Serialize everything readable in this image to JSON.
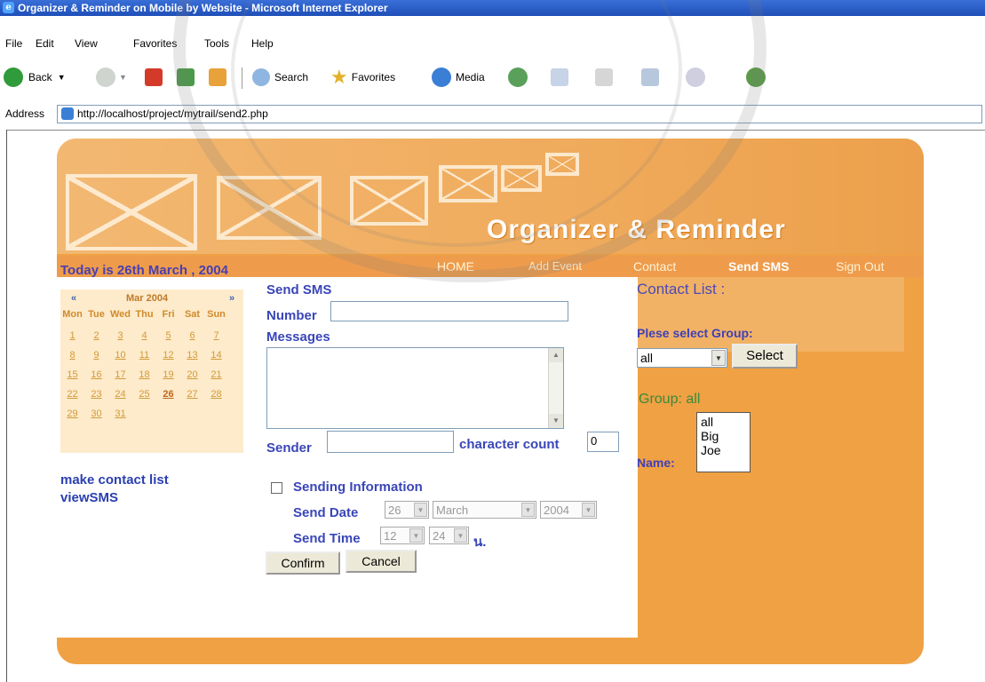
{
  "window": {
    "title": "Organizer & Reminder on Mobile by Website - Microsoft Internet Explorer"
  },
  "menu": [
    "File",
    "Edit",
    "View",
    "Favorites",
    "Tools",
    "Help"
  ],
  "toolbar": {
    "back": "Back",
    "search": "Search",
    "favorites": "Favorites",
    "media": "Media"
  },
  "address": {
    "label": "Address",
    "url": "http://localhost/project/mytrail/send2.php"
  },
  "site": {
    "title": "Organizer & Reminder",
    "today": "Today is 26th March , 2004",
    "nav": [
      "HOME",
      "Add Event",
      "Contact",
      "Send SMS",
      "Sign Out"
    ],
    "active_nav": "Send SMS"
  },
  "calendar": {
    "prev": "«",
    "next": "»",
    "month": "Mar 2004",
    "days": [
      "Mon",
      "Tue",
      "Wed",
      "Thu",
      "Fri",
      "Sat",
      "Sun"
    ],
    "weeks": [
      [
        "1",
        "2",
        "3",
        "4",
        "5",
        "6",
        "7"
      ],
      [
        "8",
        "9",
        "10",
        "11",
        "12",
        "13",
        "14"
      ],
      [
        "15",
        "16",
        "17",
        "18",
        "19",
        "20",
        "21"
      ],
      [
        "22",
        "23",
        "24",
        "25",
        "26",
        "27",
        "28"
      ],
      [
        "29",
        "30",
        "31",
        "",
        "",
        "",
        ""
      ]
    ],
    "today": "26"
  },
  "sidebar": {
    "links": [
      "make contact list",
      "viewSMS"
    ]
  },
  "form": {
    "heading": "Send SMS",
    "number_label": "Number",
    "number_value": "",
    "messages_label": "Messages",
    "message_value": "",
    "sender_label": "Sender",
    "sender_value": "",
    "char_count_label": "character count",
    "char_count_value": "0",
    "sending_info_label": "Sending Information",
    "sending_info_checked": false,
    "send_date_label": "Send Date",
    "send_date_day": "26",
    "send_date_month": "March",
    "send_date_year": "2004",
    "send_time_label": "Send Time",
    "send_time_hour": "12",
    "send_time_minute": "24",
    "time_suffix": "น.",
    "confirm": "Confirm",
    "cancel": "Cancel"
  },
  "contact": {
    "title": "Contact List :",
    "group_prompt": "Plese select Group:",
    "group_selected": "all",
    "select_button": "Select",
    "group_label": "Group: all",
    "name_label": "Name:",
    "names": [
      "all",
      "Big",
      "Joe"
    ]
  },
  "watermark": {
    "text": "มหาวิทยาลัยพระจอมเกล้าเจ้าคุณทหารลาดกระบัง"
  }
}
